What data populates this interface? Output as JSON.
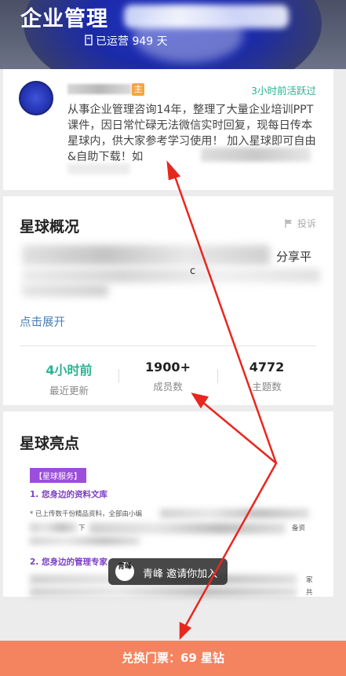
{
  "header": {
    "title": "企业管理",
    "running_days": "已运营 949 天"
  },
  "owner": {
    "badge": "主",
    "active_time": "3小时前活跃过",
    "intro": "从事企业管理咨询14年，整理了大量企业培训PPT课件，因日常忙碌无法微信实时回复，现每日传本星球内，供大家参考学习使用！ 加入星球即可自由&自助下载！如"
  },
  "overview": {
    "title": "星球概况",
    "report_label": "投诉",
    "visible_fragment_1": "分享平",
    "visible_fragment_2": "c",
    "expand_label": "点击展开",
    "stats": [
      {
        "value": "4小时前",
        "label": "最近更新"
      },
      {
        "value": "1900+",
        "label": "成员数"
      },
      {
        "value": "4772",
        "label": "主题数"
      }
    ]
  },
  "highlights": {
    "title": "星球亮点",
    "tag": "【星球服务】",
    "heading_1": "1. 您身边的资料文库",
    "line_1": "* 已上传数千份精品资料，全部由小编",
    "line_2": "下",
    "line_3": "备资",
    "heading_2": "2. 您身边的管理专家",
    "line_4": "家",
    "line_5": "共"
  },
  "invite": {
    "avatar_text": "青峰",
    "text": "青峰 邀请你加入"
  },
  "bottom_bar": {
    "label": "兑换门票：69 星钻"
  },
  "colors": {
    "accent_green": "#29b393",
    "link_blue": "#4a7db5",
    "bottom_bar": "#f4845f",
    "owner_badge": "#f3a642",
    "annotation_arrow": "#e8271f"
  }
}
